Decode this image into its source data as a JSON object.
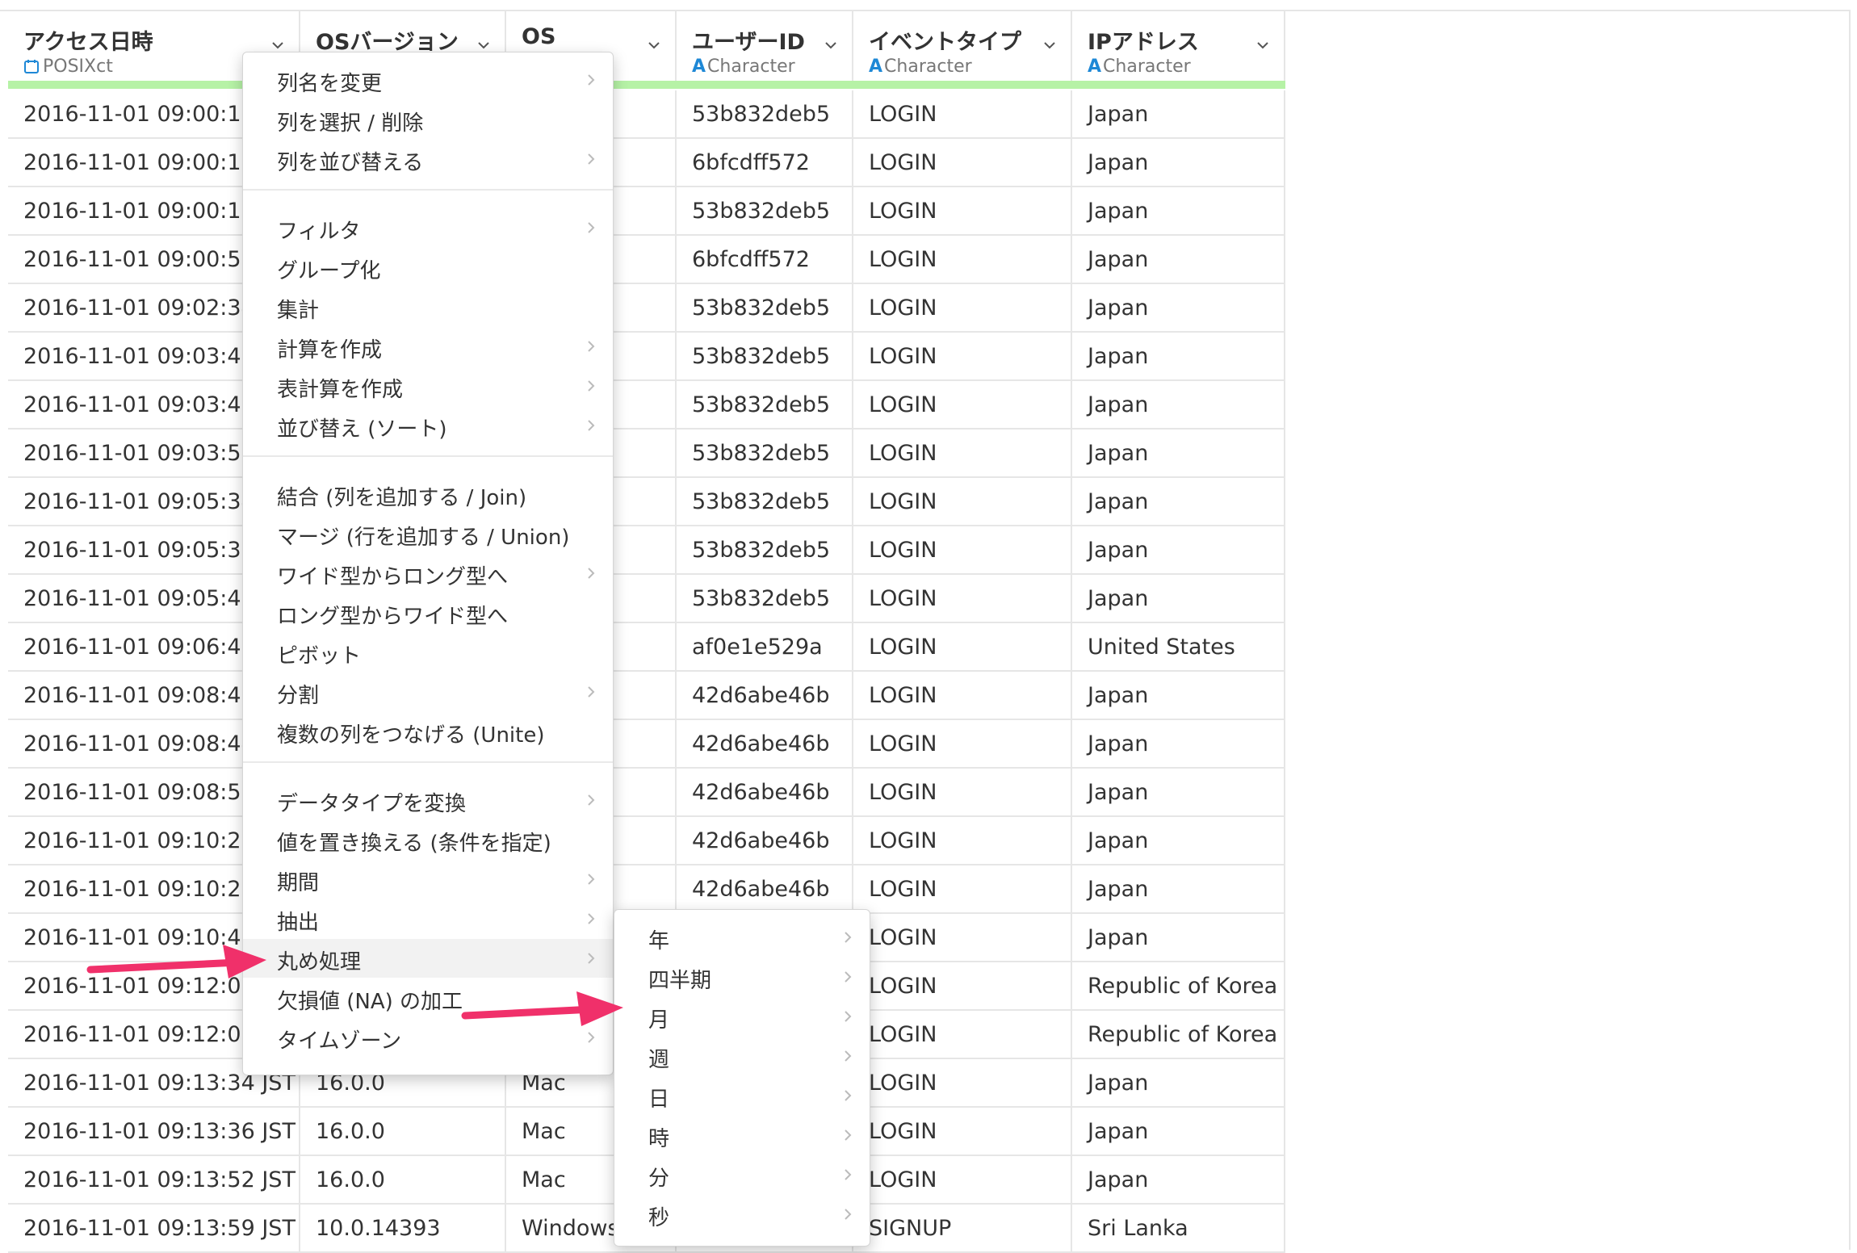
{
  "columns": [
    {
      "name": "アクセス日時",
      "type": "POSIXct",
      "type_icon": "calendar-icon"
    },
    {
      "name": "OSバージョン",
      "type": "",
      "type_icon": ""
    },
    {
      "name": "OS",
      "type": "er",
      "type_icon": ""
    },
    {
      "name": "ユーザーID",
      "type": "Character",
      "type_icon": "character-type-icon"
    },
    {
      "name": "イベントタイプ",
      "type": "Character",
      "type_icon": "character-type-icon"
    },
    {
      "name": "IPアドレス",
      "type": "Character",
      "type_icon": "character-type-icon"
    }
  ],
  "type_icon_glyph": "A",
  "rows": [
    [
      "2016-11-01 09:00:12",
      "",
      "",
      "53b832deb5",
      "LOGIN",
      "Japan"
    ],
    [
      "2016-11-01 09:00:13",
      "",
      "s",
      "6bfcdff572",
      "LOGIN",
      "Japan"
    ],
    [
      "2016-11-01 09:00:15",
      "",
      "",
      "53b832deb5",
      "LOGIN",
      "Japan"
    ],
    [
      "2016-11-01 09:00:59",
      "",
      "s",
      "6bfcdff572",
      "LOGIN",
      "Japan"
    ],
    [
      "2016-11-01 09:02:34",
      "",
      "",
      "53b832deb5",
      "LOGIN",
      "Japan"
    ],
    [
      "2016-11-01 09:03:42",
      "",
      "",
      "53b832deb5",
      "LOGIN",
      "Japan"
    ],
    [
      "2016-11-01 09:03:46",
      "",
      "",
      "53b832deb5",
      "LOGIN",
      "Japan"
    ],
    [
      "2016-11-01 09:03:56",
      "",
      "",
      "53b832deb5",
      "LOGIN",
      "Japan"
    ],
    [
      "2016-11-01 09:05:34",
      "",
      "",
      "53b832deb5",
      "LOGIN",
      "Japan"
    ],
    [
      "2016-11-01 09:05:37",
      "",
      "",
      "53b832deb5",
      "LOGIN",
      "Japan"
    ],
    [
      "2016-11-01 09:05:48",
      "",
      "",
      "53b832deb5",
      "LOGIN",
      "Japan"
    ],
    [
      "2016-11-01 09:06:41",
      "",
      "",
      "af0e1e529a",
      "LOGIN",
      "United States"
    ],
    [
      "2016-11-01 09:08:43",
      "",
      "s",
      "42d6abe46b",
      "LOGIN",
      "Japan"
    ],
    [
      "2016-11-01 09:08:44",
      "",
      "s",
      "42d6abe46b",
      "LOGIN",
      "Japan"
    ],
    [
      "2016-11-01 09:08:56",
      "",
      "s",
      "42d6abe46b",
      "LOGIN",
      "Japan"
    ],
    [
      "2016-11-01 09:10:27",
      "",
      "s",
      "42d6abe46b",
      "LOGIN",
      "Japan"
    ],
    [
      "2016-11-01 09:10:28",
      "",
      "s",
      "42d6abe46b",
      "LOGIN",
      "Japan"
    ],
    [
      "2016-11-01 09:10:42",
      "",
      "",
      "",
      "LOGIN",
      "Japan"
    ],
    [
      "2016-11-01 09:12:01",
      "",
      "",
      "",
      "LOGIN",
      "Republic of Korea"
    ],
    [
      "2016-11-01 09:12:02",
      "",
      "",
      "",
      "LOGIN",
      "Republic of Korea"
    ],
    [
      "2016-11-01 09:13:34 JST",
      "16.0.0",
      "Mac",
      "",
      "LOGIN",
      "Japan"
    ],
    [
      "2016-11-01 09:13:36 JST",
      "16.0.0",
      "Mac",
      "",
      "LOGIN",
      "Japan"
    ],
    [
      "2016-11-01 09:13:52 JST",
      "16.0.0",
      "Mac",
      "",
      "LOGIN",
      "Japan"
    ],
    [
      "2016-11-01 09:13:59 JST",
      "10.0.14393",
      "Windows",
      "",
      "SIGNUP",
      "Sri Lanka"
    ]
  ],
  "context_menu": {
    "groups": [
      [
        {
          "label": "列名を変更",
          "submenu": true
        },
        {
          "label": "列を選択 / 削除",
          "submenu": false
        },
        {
          "label": "列を並び替える",
          "submenu": true
        }
      ],
      [
        {
          "label": "フィルタ",
          "submenu": true
        },
        {
          "label": "グループ化",
          "submenu": false
        },
        {
          "label": "集計",
          "submenu": false
        },
        {
          "label": "計算を作成",
          "submenu": true
        },
        {
          "label": "表計算を作成",
          "submenu": true
        },
        {
          "label": "並び替え (ソート)",
          "submenu": true
        }
      ],
      [
        {
          "label": "結合 (列を追加する / Join)",
          "submenu": false
        },
        {
          "label": "マージ (行を追加する / Union)",
          "submenu": false
        },
        {
          "label": "ワイド型からロング型へ",
          "submenu": true
        },
        {
          "label": "ロング型からワイド型へ",
          "submenu": false
        },
        {
          "label": "ピボット",
          "submenu": false
        },
        {
          "label": "分割",
          "submenu": true
        },
        {
          "label": "複数の列をつなげる (Unite)",
          "submenu": false
        }
      ],
      [
        {
          "label": "データタイプを変換",
          "submenu": true
        },
        {
          "label": "値を置き換える (条件を指定)",
          "submenu": false
        },
        {
          "label": "期間",
          "submenu": true
        },
        {
          "label": "抽出",
          "submenu": true
        },
        {
          "label": "丸め処理",
          "submenu": true,
          "active": true
        },
        {
          "label": "欠損値 (NA) の加工",
          "submenu": false
        },
        {
          "label": "タイムゾーン",
          "submenu": true
        }
      ]
    ]
  },
  "rounding_submenu": [
    {
      "label": "年"
    },
    {
      "label": "四半期"
    },
    {
      "label": "月"
    },
    {
      "label": "週"
    },
    {
      "label": "日"
    },
    {
      "label": "時"
    },
    {
      "label": "分"
    },
    {
      "label": "秒"
    }
  ],
  "colors": {
    "header_accent": "#b6f2a6",
    "type_icon": "#1e88d6",
    "annotation_arrow": "#f0306a"
  }
}
